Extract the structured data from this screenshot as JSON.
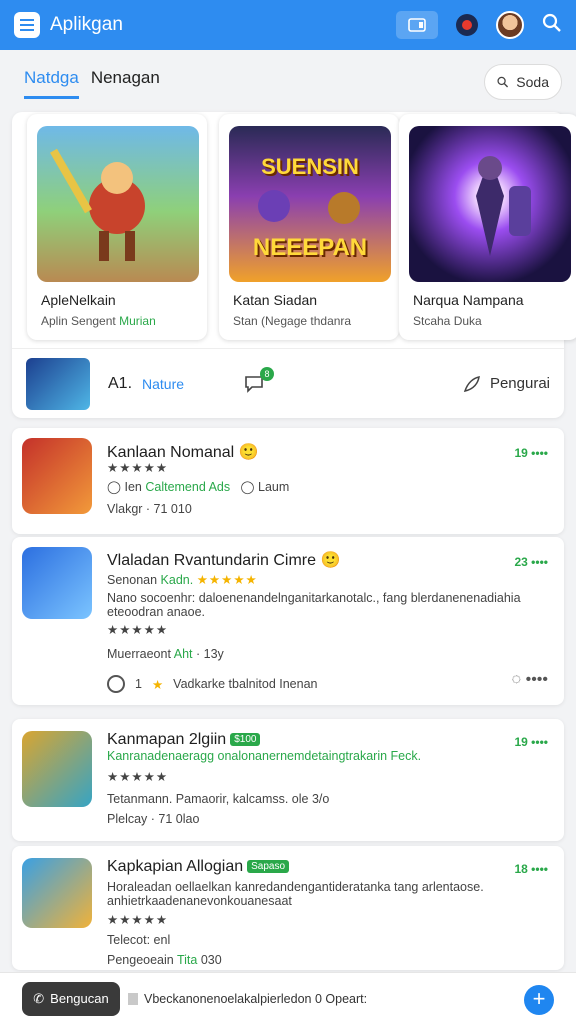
{
  "app": {
    "title": "Aplikgan"
  },
  "tabs": [
    {
      "label": "Natdga"
    },
    {
      "label": "Nenagan"
    }
  ],
  "search": {
    "label": "Soda"
  },
  "featured": [
    {
      "title": "ApleNelkain",
      "sub": "Aplin Sengent",
      "sub_accent": "Murian"
    },
    {
      "title": "Katan Siadan",
      "sub": "Stan (Negage thdanra",
      "banner_top": "SUENSIN",
      "banner_bottom": "NEEEPAN"
    },
    {
      "title": "Narqua Nampana",
      "sub": "Stcaha Duka"
    }
  ],
  "strip": {
    "label_a": "A1.",
    "label_b": "Nature",
    "badge": "8",
    "right_label": "Pengurai"
  },
  "list": [
    {
      "name": "Kanlaan Nomanal",
      "num": "19 ••••",
      "stars": "★★★★★",
      "line1_a": "Ien",
      "line1_b": "Caltemend Ads",
      "line1_c": "Laum",
      "line2": "Vlakgr · 71 010"
    },
    {
      "name": "Vlaladan Rvantundarin Cimre",
      "num": "23 ••••",
      "line1_a": "Senonan",
      "line1_b": "Kadn.",
      "stars": "★★★★★",
      "desc1": "Nano socoenhr: daloenenandelnganitarkanotalc., fang blerdanenenadiahia",
      "desc2": "eteoodran anaoe.",
      "stars2": "★★★★★",
      "line3_a": "Muerraeont",
      "line3_b": "Aht",
      "line3_c": "· 13y",
      "action_count": "1",
      "action_text": "Vadkarke tbalnitod Inenan"
    },
    {
      "name": "Kanmapan 2lgiin",
      "tag": "$100",
      "num": "19 ••••",
      "desc1": "Kanranadenaeragg onalonanernemdetaingtrakarin Feck.",
      "stars": "★★★★★",
      "line2": "Tetanmann. Pamaorir, kalcamss. ole 3/o",
      "line3": "Plelcay · 71 0lao"
    },
    {
      "name": "Kapkapian Allogian",
      "tag": "Sapaso",
      "num": "18 ••••",
      "desc1": "Horaleadan oellaelkan kanredandengantideratanka tang arlentaose.",
      "desc2": "anhietrkaadenanevonkouanesaat",
      "stars": "★★★★★",
      "line2": "Telecot: enl",
      "line3_a": "Pengeoeain",
      "line3_b": "Tita",
      "line3_c": "030"
    }
  ],
  "bottom": {
    "button": "Bengucan",
    "text": "Vbeckanonenoelakalpierledon 0 Opeart:"
  }
}
